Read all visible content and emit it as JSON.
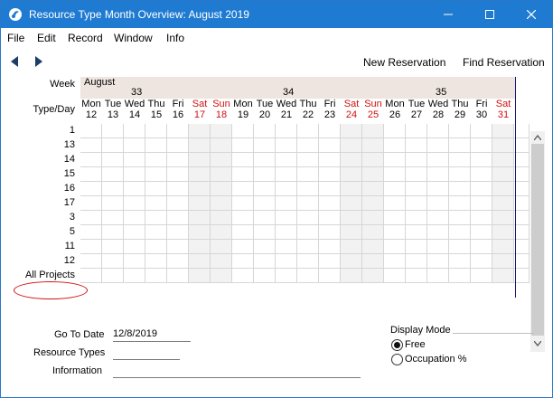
{
  "window": {
    "title": "Resource Type Month Overview: August 2019"
  },
  "menubar": {
    "items": [
      "File",
      "Edit",
      "Record",
      "Window",
      "Info"
    ]
  },
  "toolbar": {
    "new_reservation": "New Reservation",
    "find_reservation": "Find Reservation"
  },
  "grid": {
    "week_label": "Week",
    "typeday_label": "Type/Day",
    "month": "August",
    "weeks": [
      "33",
      "34",
      "35"
    ],
    "days": [
      {
        "name": "Mon",
        "num": "12",
        "weekend": false
      },
      {
        "name": "Tue",
        "num": "13",
        "weekend": false
      },
      {
        "name": "Wed",
        "num": "14",
        "weekend": false
      },
      {
        "name": "Thu",
        "num": "15",
        "weekend": false
      },
      {
        "name": "Fri",
        "num": "16",
        "weekend": false
      },
      {
        "name": "Sat",
        "num": "17",
        "weekend": true
      },
      {
        "name": "Sun",
        "num": "18",
        "weekend": true
      },
      {
        "name": "Mon",
        "num": "19",
        "weekend": false
      },
      {
        "name": "Tue",
        "num": "20",
        "weekend": false
      },
      {
        "name": "Wed",
        "num": "21",
        "weekend": false
      },
      {
        "name": "Thu",
        "num": "22",
        "weekend": false
      },
      {
        "name": "Fri",
        "num": "23",
        "weekend": false
      },
      {
        "name": "Sat",
        "num": "24",
        "weekend": true
      },
      {
        "name": "Sun",
        "num": "25",
        "weekend": true
      },
      {
        "name": "Mon",
        "num": "26",
        "weekend": false
      },
      {
        "name": "Tue",
        "num": "27",
        "weekend": false
      },
      {
        "name": "Wed",
        "num": "28",
        "weekend": false
      },
      {
        "name": "Thu",
        "num": "29",
        "weekend": false
      },
      {
        "name": "Fri",
        "num": "30",
        "weekend": false
      },
      {
        "name": "Sat",
        "num": "31",
        "weekend": true
      }
    ],
    "rows": [
      "1",
      "13",
      "14",
      "15",
      "16",
      "17",
      "3",
      "5",
      "11",
      "12",
      "All Projects"
    ]
  },
  "form": {
    "go_to_date_label": "Go To Date",
    "go_to_date_value": "12/8/2019",
    "resource_types_label": "Resource Types",
    "resource_types_value": "",
    "information_label": "Information",
    "information_value": "",
    "display_mode_label": "Display Mode",
    "display_mode_options": [
      "Free",
      "Occupation %"
    ],
    "display_mode_selected": "Free"
  },
  "colors": {
    "titlebar": "#1f7bd1",
    "weekend_text": "#d01010",
    "highlight_circle": "#d01010"
  }
}
